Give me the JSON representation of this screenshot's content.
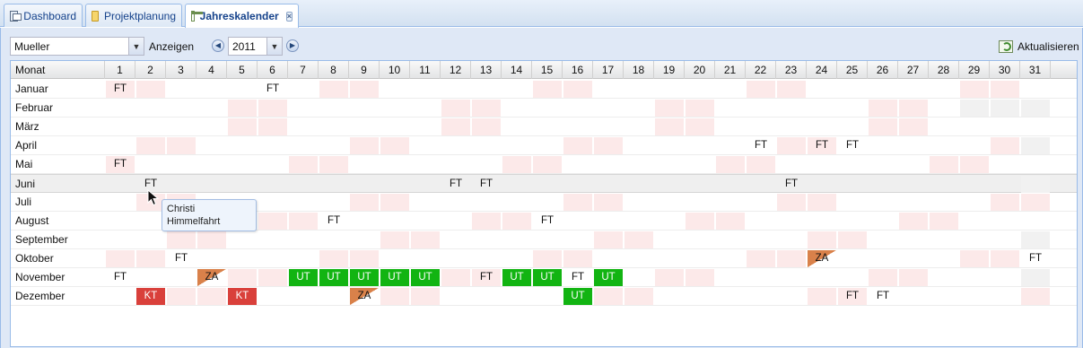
{
  "tabs": [
    {
      "label": "Dashboard",
      "icon": "dashboard-icon"
    },
    {
      "label": "Projektplanung",
      "icon": "folder-icon"
    },
    {
      "label": "Jahreskalender",
      "icon": "calendar-icon",
      "active": true
    }
  ],
  "toolbar": {
    "user_value": "Mueller",
    "show_label": "Anzeigen",
    "year_value": "2011",
    "refresh_label": "Aktualisieren"
  },
  "grid": {
    "month_header": "Monat",
    "days": [
      "1",
      "2",
      "3",
      "4",
      "5",
      "6",
      "7",
      "8",
      "9",
      "10",
      "11",
      "12",
      "13",
      "14",
      "15",
      "16",
      "17",
      "18",
      "19",
      "20",
      "21",
      "22",
      "23",
      "24",
      "25",
      "26",
      "27",
      "28",
      "29",
      "30",
      "31"
    ],
    "rows": [
      {
        "month": "Januar",
        "days_in_month": 31,
        "weekend": [
          1,
          2,
          8,
          9,
          15,
          16,
          22,
          23,
          29,
          30
        ],
        "entries": {
          "1": "FT",
          "6": "FT"
        }
      },
      {
        "month": "Februar",
        "days_in_month": 28,
        "weekend": [
          5,
          6,
          12,
          13,
          19,
          20,
          26,
          27
        ],
        "entries": {}
      },
      {
        "month": "März",
        "days_in_month": 31,
        "weekend": [
          5,
          6,
          12,
          13,
          19,
          20,
          26,
          27
        ],
        "entries": {}
      },
      {
        "month": "April",
        "days_in_month": 30,
        "weekend": [
          2,
          3,
          9,
          10,
          16,
          17,
          23,
          24,
          30
        ],
        "entries": {
          "22": "FT",
          "24": "FT",
          "25": "FT"
        }
      },
      {
        "month": "Mai",
        "days_in_month": 31,
        "weekend": [
          1,
          7,
          8,
          14,
          15,
          21,
          22,
          28,
          29
        ],
        "entries": {
          "1": "FT"
        }
      },
      {
        "month": "Juni",
        "days_in_month": 30,
        "weekend": [
          4,
          5,
          11,
          12,
          18,
          19,
          25,
          26
        ],
        "entries": {
          "2": "FT",
          "12": "FT",
          "13": "FT",
          "23": "FT"
        },
        "selected": true
      },
      {
        "month": "Juli",
        "days_in_month": 31,
        "weekend": [
          2,
          3,
          9,
          10,
          16,
          17,
          23,
          24,
          30,
          31
        ],
        "entries": {}
      },
      {
        "month": "August",
        "days_in_month": 31,
        "weekend": [
          6,
          7,
          13,
          14,
          20,
          21,
          27,
          28
        ],
        "entries": {
          "8": "FT",
          "15": "FT"
        }
      },
      {
        "month": "September",
        "days_in_month": 30,
        "weekend": [
          3,
          4,
          10,
          11,
          17,
          18,
          24,
          25
        ],
        "entries": {}
      },
      {
        "month": "Oktober",
        "days_in_month": 31,
        "weekend": [
          1,
          2,
          8,
          9,
          15,
          16,
          22,
          23,
          29,
          30
        ],
        "entries": {
          "3": "FT",
          "24": "ZA",
          "31": "FT"
        }
      },
      {
        "month": "November",
        "days_in_month": 30,
        "weekend": [
          5,
          6,
          12,
          13,
          19,
          20,
          26,
          27
        ],
        "entries": {
          "1": "FT",
          "4": "ZA",
          "7": "UT",
          "8": "UT",
          "9": "UT",
          "10": "UT",
          "11": "UT",
          "13": "FT",
          "14": "UT",
          "15": "UT",
          "16": "FT",
          "17": "UT"
        }
      },
      {
        "month": "Dezember",
        "days_in_month": 31,
        "weekend": [
          3,
          4,
          10,
          11,
          17,
          18,
          24,
          25,
          31
        ],
        "entries": {
          "2": "KT",
          "5": "KT",
          "9": "ZA",
          "16": "UT",
          "25": "FT",
          "26": "FT"
        }
      }
    ]
  },
  "tooltip": {
    "line1": "Christi",
    "line2": "Himmelfahrt"
  },
  "colors": {
    "weekend": "#fce9e9",
    "urlaub": "#12b412",
    "krank": "#d9403b",
    "zeitausgleich": "#d9814a",
    "no_day": "#f1f1f1"
  }
}
